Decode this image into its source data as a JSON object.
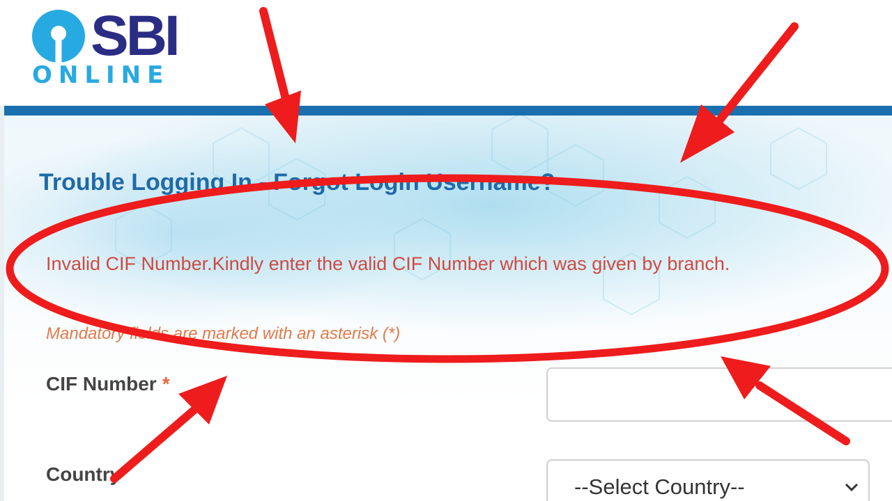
{
  "header": {
    "logo_name": "SBI",
    "logo_sub": "ONLINE",
    "brand_colors": {
      "navy": "#2b2d84",
      "cyan": "#27aae1",
      "bar": "#1a6fae"
    }
  },
  "main": {
    "title": "Trouble Logging In - Forgot Login Username?",
    "error_message": "Invalid CIF Number.Kindly enter the valid CIF Number which was given by branch.",
    "mandatory_note": "Mandatory fields are marked with an asterisk (*)",
    "fields": {
      "cif": {
        "label": "CIF Number",
        "required_mark": "*",
        "value": ""
      },
      "country": {
        "label": "Country",
        "selected": "--Select Country--"
      }
    }
  },
  "colors": {
    "title": "#1f6aa8",
    "error": "#d04a40",
    "note": "#e07a4a",
    "annotation_red": "#ee1c1c"
  },
  "icons": {
    "logo_mark": "sbi-keyhole-icon",
    "select_caret": "chevron-down-icon"
  }
}
